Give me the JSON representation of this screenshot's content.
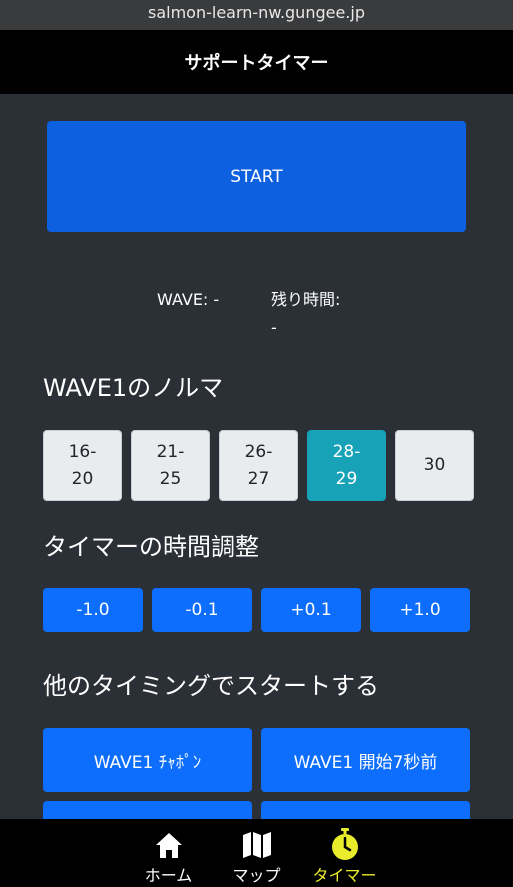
{
  "browser": {
    "url": "salmon-learn-nw.gungee.jp"
  },
  "header": {
    "title": "サポートタイマー"
  },
  "timer": {
    "start_label": "START",
    "wave_label": "WAVE: -",
    "remaining_label": "残り時間:",
    "remaining_value": "-"
  },
  "norma": {
    "heading": "WAVE1のノルマ",
    "options": [
      {
        "label": "16-\n20",
        "active": false
      },
      {
        "label": "21-\n25",
        "active": false
      },
      {
        "label": "26-\n27",
        "active": false
      },
      {
        "label": "28-\n29",
        "active": true
      },
      {
        "label": "30",
        "active": false
      }
    ]
  },
  "adjust": {
    "heading": "タイマーの時間調整",
    "buttons": [
      "-1.0",
      "-0.1",
      "+0.1",
      "+1.0"
    ]
  },
  "other_start": {
    "heading": "他のタイミングでスタートする",
    "buttons": [
      "WAVE1 ﾁｬﾎﾟﾝ",
      "WAVE1 開始7秒前",
      "",
      ""
    ]
  },
  "nav": {
    "items": [
      {
        "label": "ホーム",
        "icon": "home-icon",
        "active": false
      },
      {
        "label": "マップ",
        "icon": "map-icon",
        "active": false
      },
      {
        "label": "タイマー",
        "icon": "stopwatch-icon",
        "active": true
      }
    ],
    "active_color": "#e8ec2a"
  },
  "colors": {
    "primary": "#0d6efd",
    "start": "#0d60e0",
    "active_norma": "#17a2b8",
    "background": "#2b2f36"
  }
}
